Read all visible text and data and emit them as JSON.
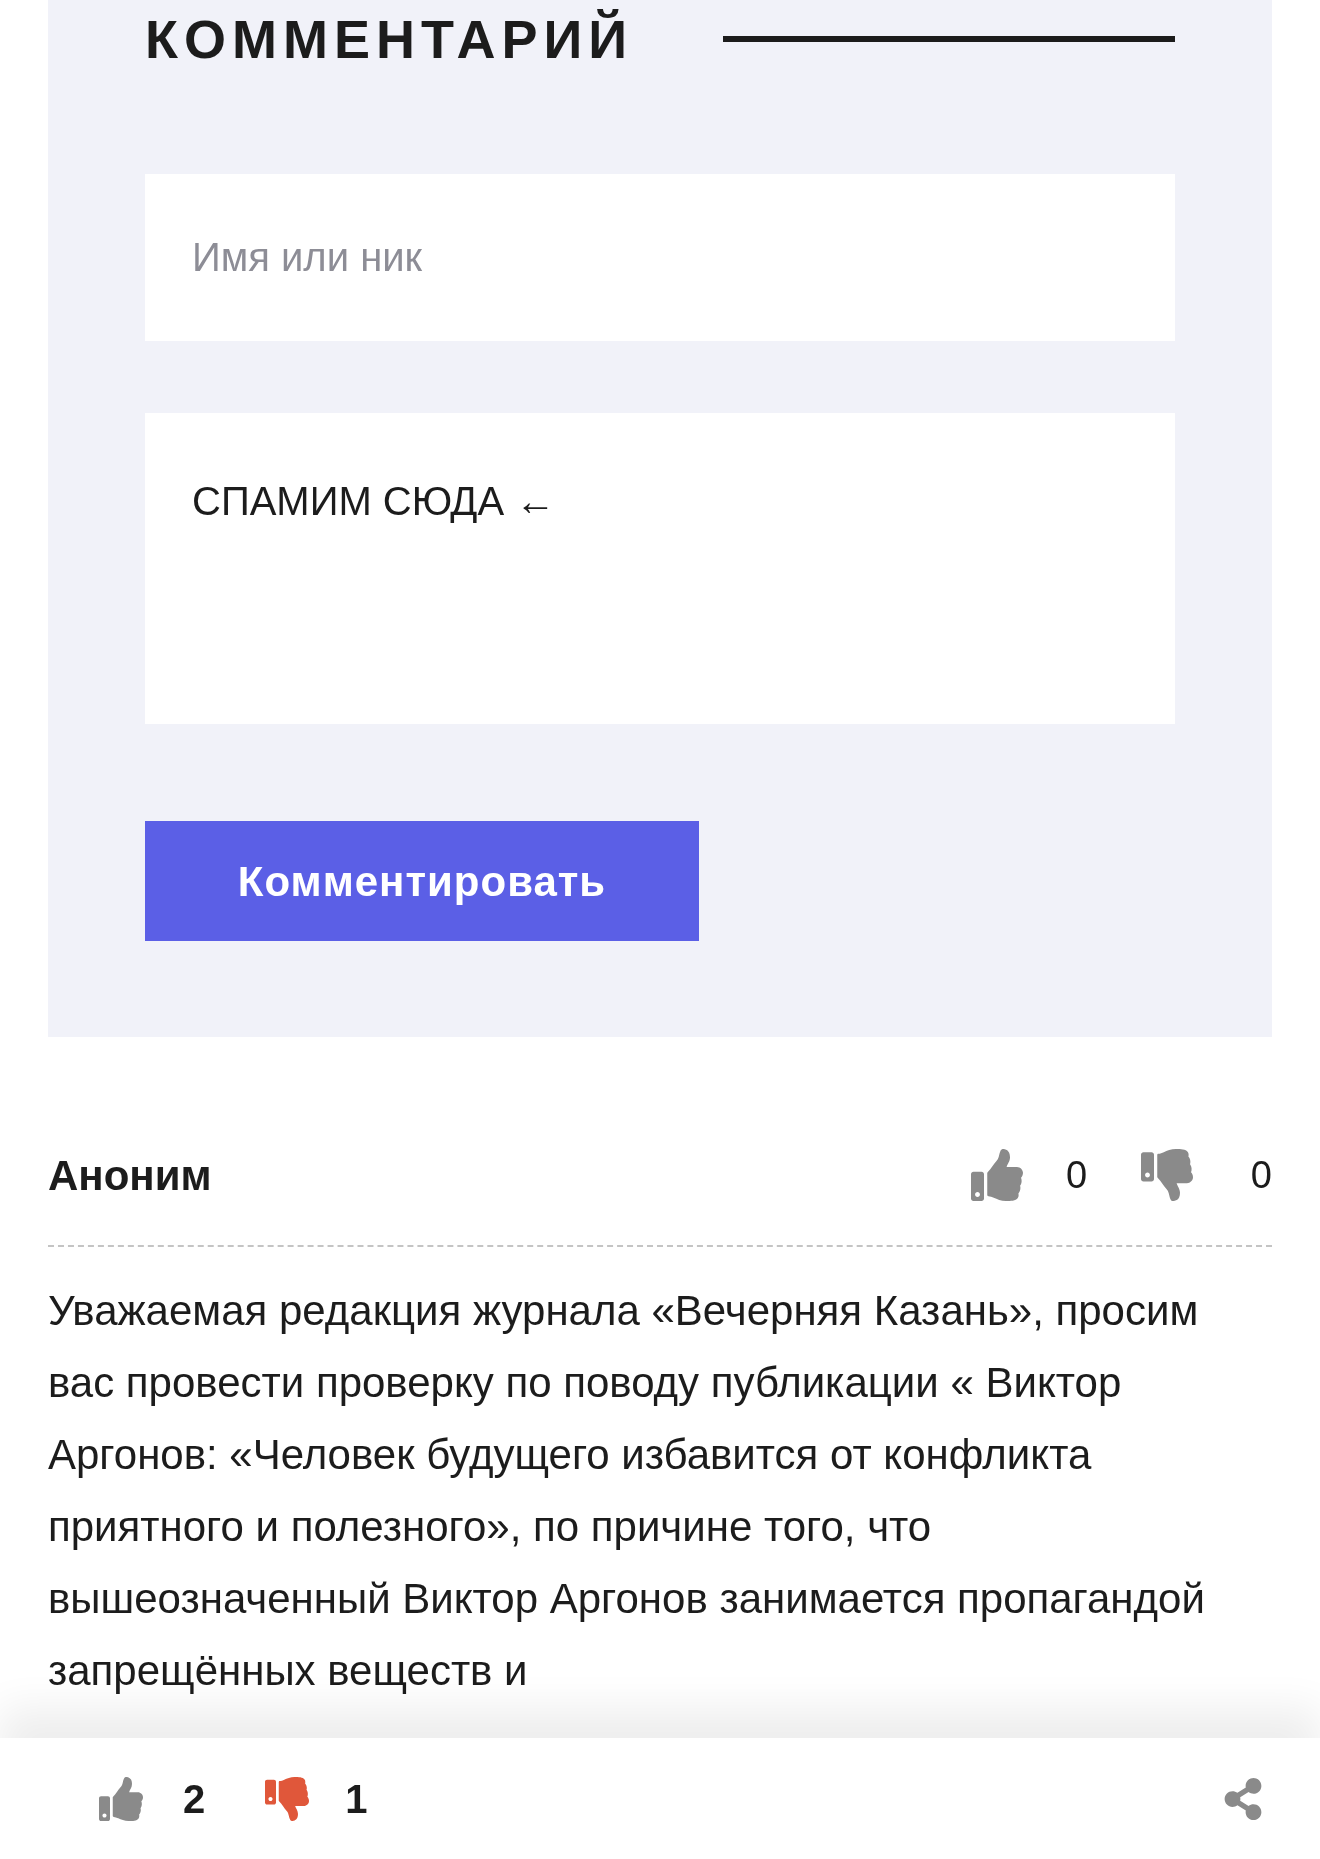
{
  "form": {
    "title": "КОММЕНТАРИЙ",
    "name_field": {
      "placeholder": "Имя или ник"
    },
    "comment_field": {
      "value": "СПАМИМ СЮДА ←"
    },
    "submit_button": "Комментировать"
  },
  "comments": [
    {
      "author": "Аноним",
      "likes": "0",
      "dislikes": "0",
      "text": "Уважаемая редакция журнала «Вечерняя Казань», просим вас провести проверку по поводу публикации « Виктор Аргонов: «Человек будущего избавится от конфликта приятного и полезного», по причине того, что вышеозначенный Виктор Аргонов занимается пропагандой запрещённых веществ и"
    }
  ],
  "article_votes": {
    "likes": {
      "count": "2",
      "selected": false
    },
    "dislikes": {
      "count": "1",
      "selected": true
    }
  }
}
